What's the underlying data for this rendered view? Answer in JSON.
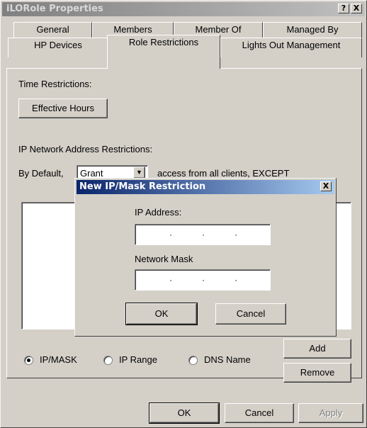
{
  "window": {
    "title": "iLORole Properties",
    "help_label": "?",
    "close_label": "X"
  },
  "tabs_row1": [
    {
      "label": "General"
    },
    {
      "label": "Members"
    },
    {
      "label": "Member Of"
    },
    {
      "label": "Managed By"
    }
  ],
  "tabs_row2": [
    {
      "label": "HP Devices"
    },
    {
      "label": "Role Restrictions"
    },
    {
      "label": "Lights Out Management"
    }
  ],
  "active_tab": "Role Restrictions",
  "panel": {
    "time_label": "Time Restrictions:",
    "effective_hours_label": "Effective Hours",
    "ip_label": "IP Network Address Restrictions:",
    "by_default_label": "By Default,",
    "default_value": "Grant",
    "access_text": "access from all clients, EXCEPT",
    "radios": [
      {
        "label": "IP/MASK",
        "checked": true
      },
      {
        "label": "IP Range",
        "checked": false
      },
      {
        "label": "DNS Name",
        "checked": false
      }
    ],
    "add_label": "Add",
    "remove_label": "Remove"
  },
  "footer": {
    "ok_label": "OK",
    "cancel_label": "Cancel",
    "apply_label": "Apply"
  },
  "dialog": {
    "title": "New IP/Mask Restriction",
    "close_label": "X",
    "ip_label": "IP Address:",
    "mask_label": "Network Mask",
    "ok_label": "OK",
    "cancel_label": "Cancel"
  }
}
